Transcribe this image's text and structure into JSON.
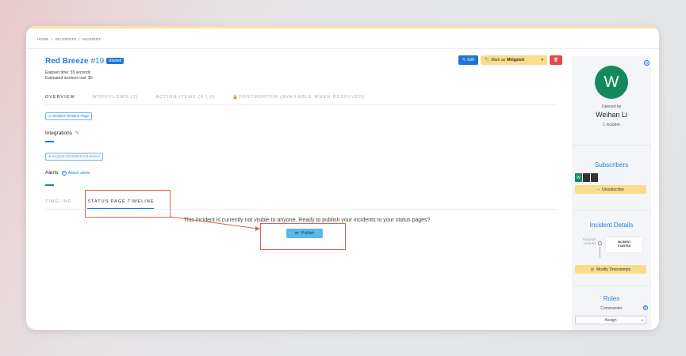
{
  "breadcrumb": [
    "HOME",
    "/",
    "INCIDENTS",
    "/",
    "INCIDENT"
  ],
  "incident": {
    "name": "Red Breeze",
    "number": "#19",
    "status": "Started",
    "elapsed": "Elapsed time: 55 seconds",
    "cost": "Estimated incident cost: $0"
  },
  "actions": {
    "edit": "Edit",
    "mitigate_prefix": "Mark as",
    "mitigate_value": "Mitigated"
  },
  "tabs": [
    "OVERVIEW",
    "WORKFLOWS (2)",
    "ACTION ITEMS (0 | 0)",
    "POSTMORTEM (AVAILABLE WHEN RESOLVED)"
  ],
  "overview": {
    "timeline_page": "Incident Timeline Page",
    "integrations_label": "Integrations",
    "integration_chip": "incident-20220819-red-breeze",
    "alerts_label": "Alerts",
    "attach_alerts": "Attach alerts"
  },
  "subtabs": [
    "TIMELINE",
    "STATUS PAGE TIMELINE"
  ],
  "status_page": {
    "notice": "This incident is currently not visible to anyone. Ready to publish your incidents to your status pages?",
    "publish": "Publish"
  },
  "sidebar": {
    "avatar_letter": "W",
    "opened_by": "Opened by",
    "user_name": "Weihan Li",
    "incident_count": "1 incident",
    "subscribers_title": "Subscribers",
    "subscriber_avatars": [
      "W",
      "",
      ""
    ],
    "unsubscribe": "Unsubscribe",
    "details_title": "Incident Details",
    "timeline_time": [
      "TODAY AT",
      "12:18 PM"
    ],
    "timeline_event": [
      "INCIDENT",
      "STARTED"
    ],
    "modify_timestamps": "Modify Timestamps",
    "roles_title": "Roles",
    "role_name": "Commander",
    "assign": "Assign"
  },
  "colors": {
    "accent": "#1e75d8",
    "mitigate": "#f9dc8c",
    "danger": "#e04a4a",
    "avatar": "#138a5e",
    "highlight": "#e0614e"
  }
}
